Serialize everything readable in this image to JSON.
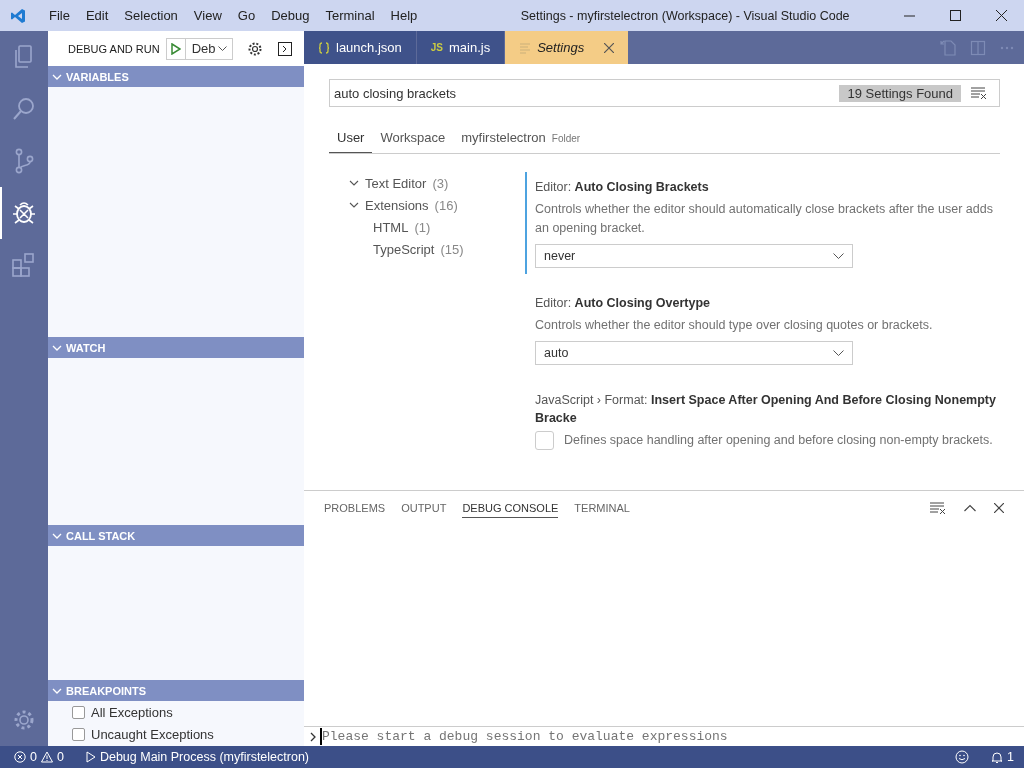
{
  "window": {
    "title": "Settings - myfirstelectron (Workspace) - Visual Studio Code"
  },
  "menu": [
    "File",
    "Edit",
    "Selection",
    "View",
    "Go",
    "Debug",
    "Terminal",
    "Help"
  ],
  "activity_bar": [
    {
      "kind": "files",
      "selected": false
    },
    {
      "kind": "search",
      "selected": false
    },
    {
      "kind": "scm",
      "selected": false
    },
    {
      "kind": "debug",
      "selected": true
    },
    {
      "kind": "extensions",
      "selected": false
    }
  ],
  "sidebar": {
    "title": "DEBUG AND RUN",
    "configuration": "Deb",
    "sections": [
      {
        "title": "VARIABLES",
        "expanded": true
      },
      {
        "title": "WATCH",
        "expanded": true
      },
      {
        "title": "CALL STACK",
        "expanded": true
      },
      {
        "title": "BREAKPOINTS",
        "expanded": true,
        "items": [
          {
            "label": "All Exceptions",
            "checked": false
          },
          {
            "label": "Uncaught Exceptions",
            "checked": false
          }
        ]
      }
    ]
  },
  "editor_tabs": [
    {
      "label": "launch.json",
      "kind": "json",
      "selected": false
    },
    {
      "label": "main.js",
      "kind": "js",
      "icon_text": "JS",
      "selected": false
    },
    {
      "label": "Settings",
      "kind": "settings",
      "selected": true
    }
  ],
  "settings": {
    "search": {
      "value": "auto closing brackets"
    },
    "results_badge": "19 Settings Found",
    "scopes": [
      {
        "label": "User",
        "selected": true
      },
      {
        "label": "Workspace",
        "selected": false
      },
      {
        "label": "myfirstelectron",
        "hint": "Folder",
        "selected": false
      }
    ],
    "toc": [
      {
        "label": "Text Editor",
        "count": "(3)",
        "expanded": true
      },
      {
        "label": "Extensions",
        "count": "(16)",
        "expanded": true,
        "children": [
          {
            "label": "HTML",
            "count": "(1)"
          },
          {
            "label": "TypeScript",
            "count": "(15)"
          }
        ]
      }
    ],
    "items": [
      {
        "kind": "select",
        "title": "Editor: **Auto Closing Brackets**",
        "description": "Controls whether the editor should automatically close brackets after the user adds an opening bracket.",
        "value": "never",
        "focused": true
      },
      {
        "kind": "select",
        "title": "Editor: **Auto Closing Overtype**",
        "description": "Controls whether the editor should type over closing quotes or brackets.",
        "value": "auto",
        "focused": false
      },
      {
        "kind": "checkbox",
        "title": "JavaScript › Format: **Insert Space After Opening And Before Closing Nonempty Bracke**",
        "description": "Defines space handling after opening and before closing non-empty brackets.",
        "checked": false,
        "focused": false
      }
    ]
  },
  "panel": {
    "tabs": [
      {
        "label": "PROBLEMS",
        "selected": false
      },
      {
        "label": "OUTPUT",
        "selected": false
      },
      {
        "label": "DEBUG CONSOLE",
        "selected": true
      },
      {
        "label": "TERMINAL",
        "selected": false
      }
    ],
    "console_placeholder": "Please start a debug session to evaluate expressions"
  },
  "status_bar": {
    "errors": "0",
    "warnings": "0",
    "launch": "Debug Main Process (myfirstelectron)",
    "notifications": "1"
  }
}
